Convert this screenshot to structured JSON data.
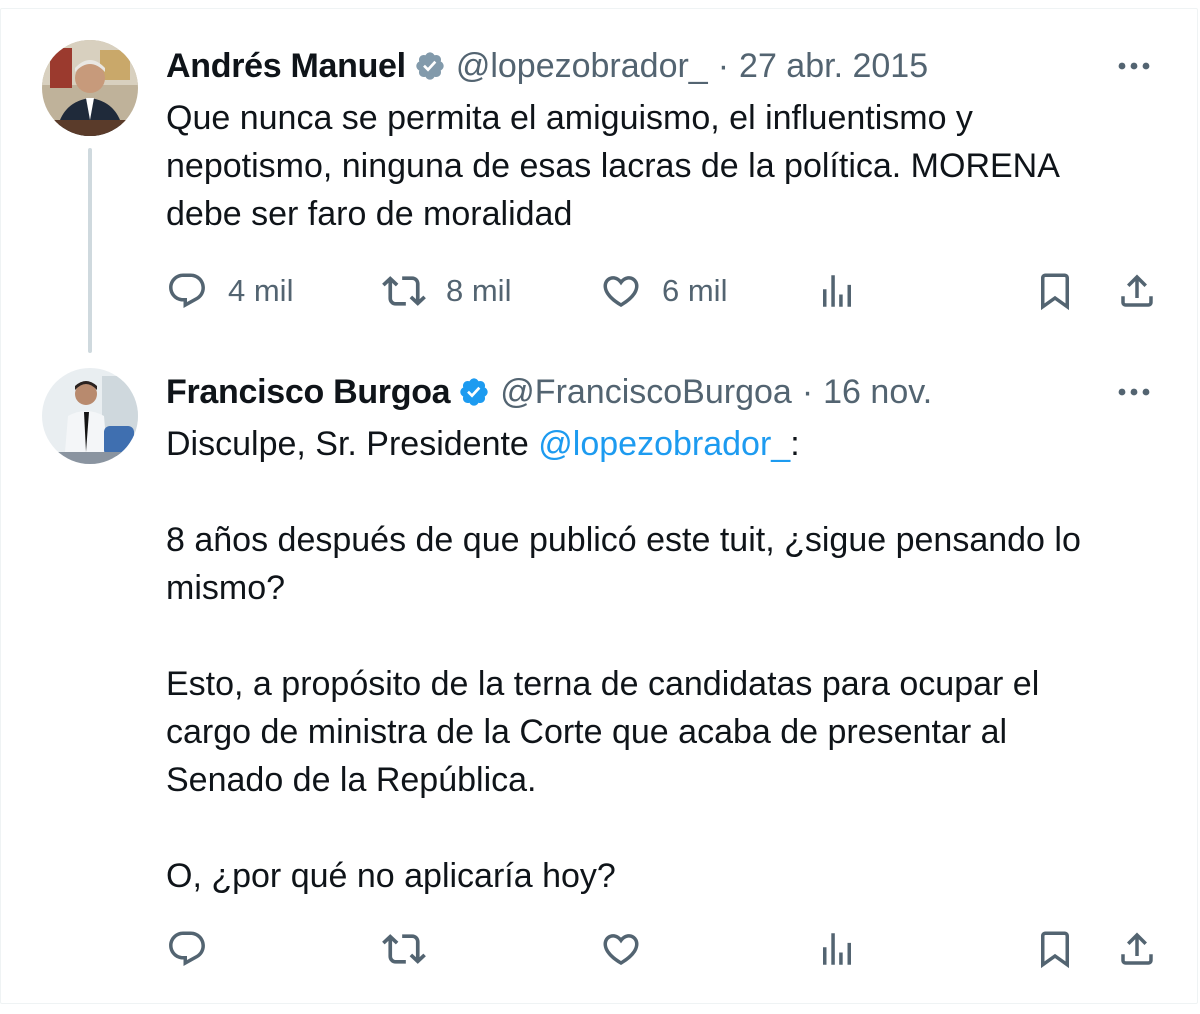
{
  "tweets": [
    {
      "name": "Andrés Manuel",
      "handle": "@lopezobrador_",
      "separator": "·",
      "date": "27 abr. 2015",
      "text_lines": [
        "Que nunca se permita el amiguismo, el influentismo y",
        "nepotismo, ninguna de esas lacras de la política. MORENA",
        "debe ser faro de moralidad"
      ],
      "reply_count": "4 mil",
      "retweet_count": "8 mil",
      "like_count": "6 mil"
    },
    {
      "name": "Francisco Burgoa",
      "handle": "@FranciscoBurgoa",
      "separator": "·",
      "date": "16 nov.",
      "intro": "Disculpe, Sr. Presidente ",
      "mention": "@lopezobrador_",
      "intro_end": ":",
      "para2_line1": "8 años después de que publicó este tuit, ¿sigue pensando lo",
      "para2_line2": "mismo?",
      "para3_line1": "Esto, a propósito de la terna de candidatas para ocupar el",
      "para3_line2": "cargo de ministra de la Corte que acaba de presentar al",
      "para3_line3": "Senado de la República.",
      "para4_line1": "O, ¿por qué no aplicaría hoy?"
    }
  ],
  "colors": {
    "verified": "#1d9bf0",
    "verified_gray": "#829aab",
    "secondary": "#536471",
    "link": "#1d9bf0"
  },
  "icons": [
    "verified-badge-icon",
    "more-icon",
    "reply-icon",
    "retweet-icon",
    "like-icon",
    "views-icon",
    "bookmark-icon",
    "share-icon"
  ]
}
